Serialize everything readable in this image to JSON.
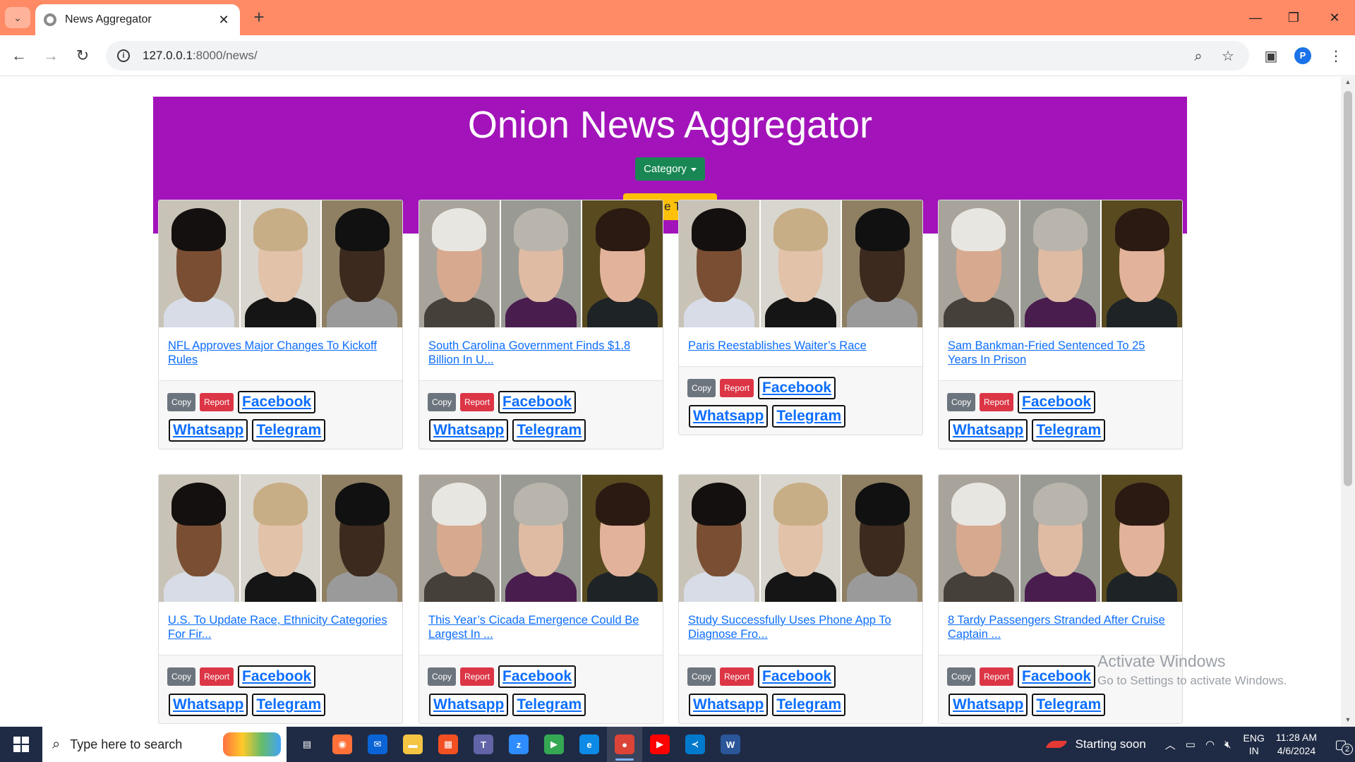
{
  "browser": {
    "tab_title": "News Aggregator",
    "url_host": "127.0.0.1",
    "url_path": ":8000/news/",
    "profile_initial": "P",
    "accent_color": "#ff8a65"
  },
  "header": {
    "title": "Onion News Aggregator",
    "category_label": "Category",
    "theme_label": "Change Theme",
    "background_color": "#a214b9"
  },
  "labels": {
    "copy": "Copy",
    "report": "Report",
    "facebook": "Facebook",
    "whatsapp": "Whatsapp",
    "telegram": "Telegram"
  },
  "articles": [
    {
      "title": "NFL Approves Major Changes To Kickoff Rules",
      "image": "set-a"
    },
    {
      "title": "South Carolina Government Finds $1.8 Billion In U...",
      "image": "set-b"
    },
    {
      "title": "Paris Reestablishes Waiter’s Race",
      "image": "set-a"
    },
    {
      "title": "Sam Bankman-Fried Sentenced To 25 Years In Prison",
      "image": "set-b"
    },
    {
      "title": "U.S. To Update Race, Ethnicity Categories For Fir...",
      "image": "set-a"
    },
    {
      "title": "This Year’s Cicada Emergence Could Be Largest In ...",
      "image": "set-b"
    },
    {
      "title": "Study Successfully Uses Phone App To Diagnose Fro...",
      "image": "set-a"
    },
    {
      "title": "8 Tardy Passengers Stranded After Cruise Captain ...",
      "image": "set-b"
    }
  ],
  "watermark": {
    "line1": "Activate Windows",
    "line2": "Go to Settings to activate Windows."
  },
  "taskbar": {
    "search_placeholder": "Type here to search",
    "weather_text": "Starting soon",
    "lang_line1": "ENG",
    "lang_line2": "IN",
    "time": "11:28 AM",
    "date": "4/6/2024",
    "notification_count": "2",
    "apps": [
      "task-view",
      "firefox",
      "mail",
      "file-explorer",
      "microsoft-store",
      "teams",
      "zoom",
      "google-play",
      "edge",
      "chrome",
      "youtube",
      "vscode",
      "word"
    ]
  }
}
